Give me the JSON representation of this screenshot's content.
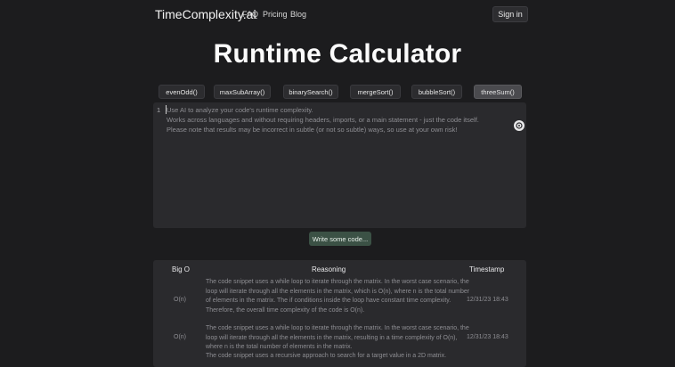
{
  "nav": {
    "brand": "TimeComplexity.ai",
    "links": [
      "FAQ",
      "Pricing",
      "Blog"
    ],
    "signin": "Sign in"
  },
  "title": "Runtime Calculator",
  "examples": [
    "evenOdd()",
    "maxSubArray()",
    "binarySearch()",
    "mergeSort()",
    "bubbleSort()",
    "threeSum()"
  ],
  "active_example": "threeSum()",
  "editor": {
    "line_number": "1",
    "placeholder_lines": [
      "Use AI to analyze your code's runtime complexity.",
      "Works across languages and without requiring headers, imports, or a main statement - just the code itself.",
      "Please note that results may be incorrect in subtle (or not so subtle) ways, so use at your own risk!"
    ]
  },
  "write_button": "Write some code...",
  "results": {
    "headers": [
      "Big O",
      "Reasoning",
      "Timestamp"
    ],
    "rows": [
      {
        "big_o": "O(n)",
        "reasoning": "The code snippet uses a while loop to iterate through the matrix. In the worst case scenario, the loop will iterate through all the elements in the matrix, which is O(n), where n is the total number of elements in the matrix. The if conditions inside the loop have constant time complexity. Therefore, the overall time complexity of the code is O(n).",
        "timestamp": "12/31/23 18:43"
      },
      {
        "big_o": "O(n)",
        "reasoning": "The code snippet uses a while loop to iterate through the matrix. In the worst case scenario, the loop will iterate through all the elements in the matrix, resulting in a time complexity of O(n), where n is the total number of elements in the matrix.",
        "timestamp": "12/31/23 18:43"
      },
      {
        "big_o": "",
        "reasoning": "The code snippet uses a recursive approach to search for a target value in a 2D matrix.",
        "timestamp": ""
      }
    ]
  },
  "colors": {
    "background": "#1c1c1e",
    "panel": "#2a2a2d",
    "write_button": "#3b5145",
    "muted_text": "#8e8e93"
  }
}
